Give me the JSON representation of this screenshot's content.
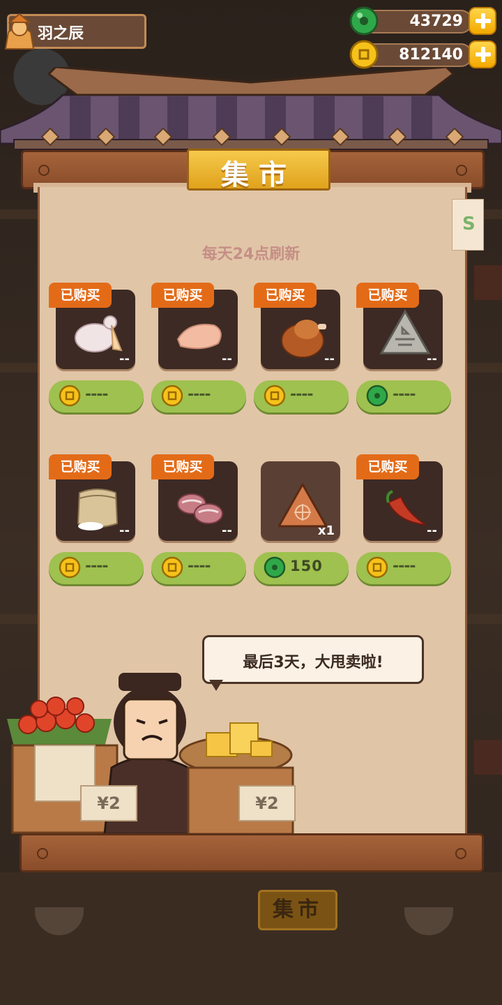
{
  "header": {
    "username": "羽之辰",
    "jade": "43729",
    "coins": "812140"
  },
  "shop": {
    "title": "集市",
    "refresh_note": "每天24点刷新",
    "items": [
      {
        "badge": "已购买",
        "qty": "--",
        "price": "----",
        "currency": "coin",
        "icon": "goose-icon"
      },
      {
        "badge": "已购买",
        "qty": "--",
        "price": "----",
        "currency": "coin",
        "icon": "chicken-breast-icon"
      },
      {
        "badge": "已购买",
        "qty": "--",
        "price": "----",
        "currency": "coin",
        "icon": "roast-chicken-icon"
      },
      {
        "badge": "已购买",
        "qty": "--",
        "price": "----",
        "currency": "jade",
        "icon": "stone-tablet-icon"
      },
      {
        "badge": "已购买",
        "qty": "--",
        "price": "----",
        "currency": "coin",
        "icon": "flour-sack-icon"
      },
      {
        "badge": "已购买",
        "qty": "--",
        "price": "----",
        "currency": "coin",
        "icon": "pork-belly-icon"
      },
      {
        "badge": "",
        "qty": "x1",
        "price": "150",
        "currency": "jade",
        "icon": "rice-dumpling-icon"
      },
      {
        "badge": "已购买",
        "qty": "--",
        "price": "----",
        "currency": "coin",
        "icon": "chili-pepper-icon"
      }
    ],
    "merchant_speech": "最后3天，大甩卖啦!"
  },
  "background": {
    "stall_sign": "集市"
  }
}
